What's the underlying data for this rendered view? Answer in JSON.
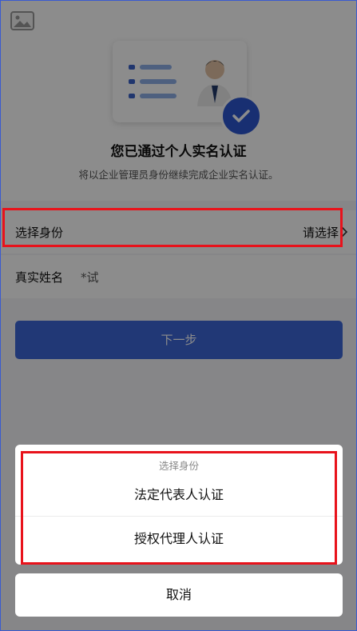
{
  "hero": {
    "title": "您已通过个人实名认证",
    "subtitle": "将以企业管理员身份继续完成企业实名认证。"
  },
  "form": {
    "identity_label": "选择身份",
    "identity_value": "请选择",
    "name_label": "真实姓名",
    "name_value": "*试"
  },
  "next_button": "下一步",
  "action_sheet": {
    "title": "选择身份",
    "options": [
      "法定代表人认证",
      "授权代理人认证"
    ],
    "cancel": "取消"
  },
  "icons": [
    "image-placeholder-icon",
    "id-card-illustration",
    "check-badge-icon",
    "chevron-right-icon"
  ],
  "colors": {
    "primary": "#3d66d8",
    "highlight": "#e8121b",
    "overlay": "rgba(0,0,0,0.45)"
  }
}
